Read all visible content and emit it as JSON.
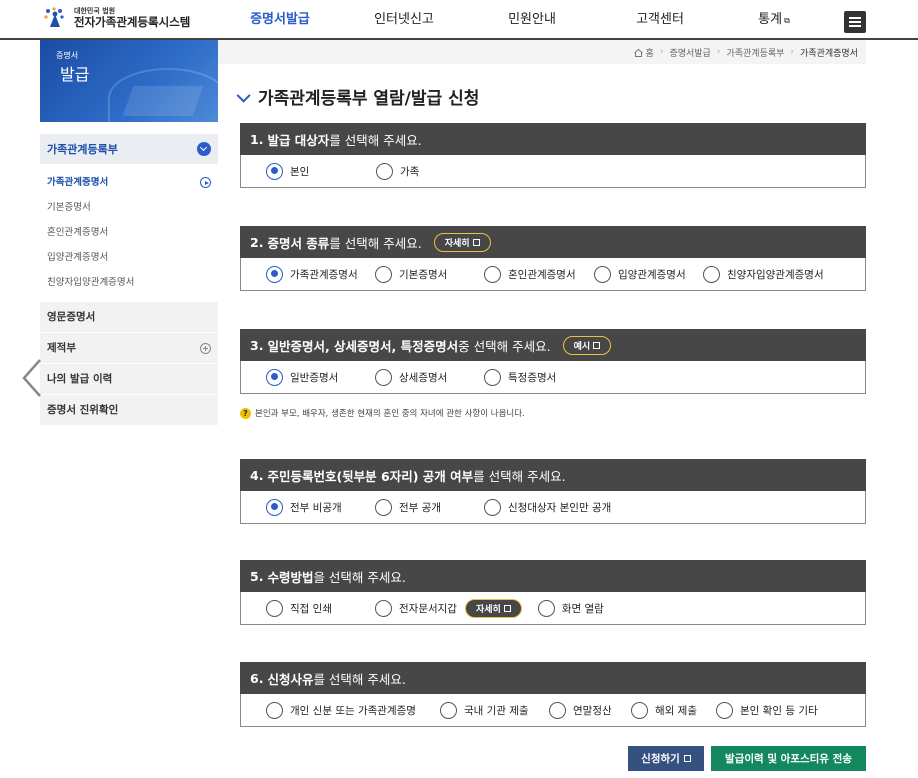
{
  "header": {
    "logo_top": "대한민국 법원",
    "logo_main": "전자가족관계등록시스템",
    "nav": [
      {
        "label": "증명서발급",
        "active": true
      },
      {
        "label": "인터넷신고",
        "active": false
      },
      {
        "label": "민원안내",
        "active": false
      },
      {
        "label": "고객센터",
        "active": false
      },
      {
        "label": "통계",
        "active": false
      }
    ]
  },
  "banner": {
    "line1": "증명서",
    "line2": "발급"
  },
  "sidebar": {
    "head": "가족관계등록부",
    "sub_items": [
      "가족관계증명서",
      "기본증명서",
      "혼인관계증명서",
      "입양관계증명서",
      "친양자입양관계증명서"
    ],
    "menus": [
      "영문증명서",
      "제적부",
      "나의 발급 이력",
      "증명서 진위확인"
    ]
  },
  "breadcrumb": [
    "홈",
    "증명서발급",
    "가족관계등록부",
    "가족관계증명서"
  ],
  "page_title": "가족관계등록부 열람/발급 신청",
  "sections": [
    {
      "num": "1.",
      "bold": "발급 대상자",
      "rest": "를 선택해 주세요.",
      "options": [
        "본인",
        "가족"
      ],
      "selected": 0
    },
    {
      "num": "2.",
      "bold": "증명서 종류",
      "rest": "를 선택해 주세요.",
      "pill": "자세히",
      "options": [
        "가족관계증명서",
        "기본증명서",
        "혼인관계증명서",
        "입양관계증명서",
        "친양자입양관계증명서"
      ],
      "selected": 0
    },
    {
      "num": "3.",
      "bold": "일반증명서, 상세증명서, 특정증명서",
      "rest": " 중 선택해 주세요.",
      "pill": "예시",
      "options": [
        "일반증명서",
        "상세증명서",
        "특정증명서"
      ],
      "selected": 0
    },
    {
      "num": "4.",
      "bold": "주민등록번호(뒷부분 6자리) 공개 여부",
      "rest": "를 선택해 주세요.",
      "options": [
        "전부 비공개",
        "전부 공개",
        "신청대상자 본인만 공개"
      ],
      "selected": 0
    },
    {
      "num": "5.",
      "bold": "수령방법",
      "rest": "을 선택해 주세요.",
      "options": [
        "직접 인쇄",
        "전자문서지갑",
        "화면 열람"
      ],
      "inline_pill": "자세히",
      "selected": -1
    },
    {
      "num": "6.",
      "bold": "신청사유",
      "rest": "를 선택해 주세요.",
      "options": [
        "개인 신분 또는 가족관계증명",
        "국내 기관 제출",
        "연말정산",
        "해외 제출",
        "본인 확인 등 기타"
      ],
      "selected": -1
    }
  ],
  "note": "본인과 부모, 배우자, 생존한 현재의 혼인 중의 자녀에 관한 사항이 나옵니다.",
  "buttons": {
    "apply": "신청하기",
    "history": "발급이력 및 아포스티유 전송"
  },
  "colors": {
    "accent": "#2a5dc9",
    "section_head": "#474747",
    "apply_btn": "#35517f",
    "history_btn": "#13885e"
  }
}
